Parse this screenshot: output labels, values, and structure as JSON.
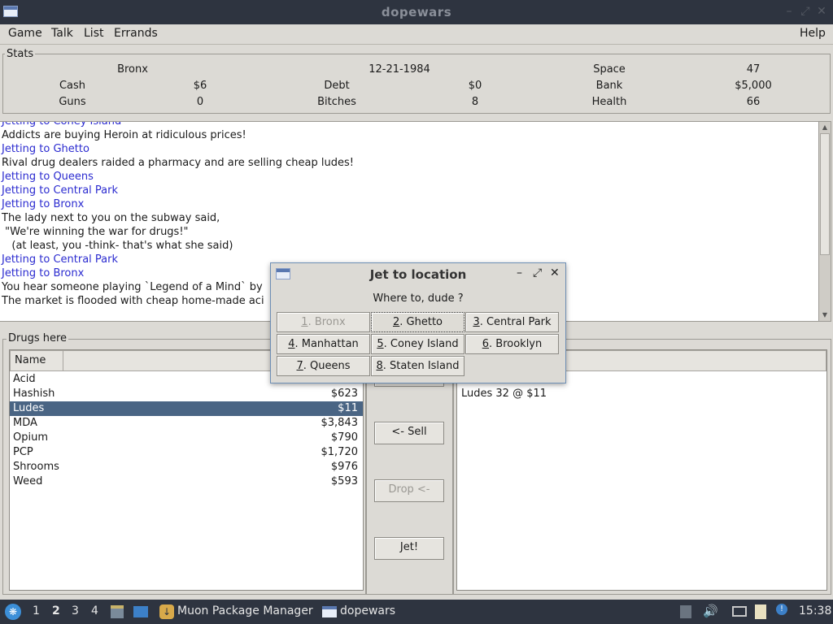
{
  "window": {
    "title": "dopewars"
  },
  "menu": {
    "game": "Game",
    "talk": "Talk",
    "list": "List",
    "errands": "Errands",
    "help": "Help"
  },
  "stats": {
    "frame_label": "Stats",
    "location": "Bronx",
    "date": "12-21-1984",
    "space_label": "Space",
    "space_value": "47",
    "cash_label": "Cash",
    "cash_value": "$6",
    "debt_label": "Debt",
    "debt_value": "$0",
    "bank_label": "Bank",
    "bank_value": "$5,000",
    "guns_label": "Guns",
    "guns_value": "0",
    "bitches_label": "Bitches",
    "bitches_value": "8",
    "health_label": "Health",
    "health_value": "66"
  },
  "log": [
    {
      "text": "Jetting to Coney Island",
      "kind": "travel"
    },
    {
      "text": "Addicts are buying Heroin at ridiculous prices!",
      "kind": "event"
    },
    {
      "text": "Jetting to Ghetto",
      "kind": "travel"
    },
    {
      "text": "Rival drug dealers raided a pharmacy and are selling cheap ludes!",
      "kind": "event"
    },
    {
      "text": "Jetting to Queens",
      "kind": "travel"
    },
    {
      "text": "Jetting to Central Park",
      "kind": "travel"
    },
    {
      "text": "Jetting to Bronx",
      "kind": "travel"
    },
    {
      "text": "The lady next to you on the subway said,",
      "kind": "event"
    },
    {
      "text": " \"We're winning the war for drugs!\"",
      "kind": "event"
    },
    {
      "text": "   (at least, you -think- that's what she said)",
      "kind": "event"
    },
    {
      "text": "Jetting to Central Park",
      "kind": "travel"
    },
    {
      "text": "Jetting to Bronx",
      "kind": "travel"
    },
    {
      "text": "You hear someone playing `Legend of a Mind` by",
      "kind": "event"
    },
    {
      "text": "The market is flooded with cheap home-made aci",
      "kind": "event"
    }
  ],
  "drugs_here": {
    "frame_label": "Drugs here",
    "column_name": "Name",
    "items": [
      {
        "name": "Acid",
        "price": ""
      },
      {
        "name": "Hashish",
        "price": "$623"
      },
      {
        "name": "Ludes",
        "price": "$11",
        "selected": true
      },
      {
        "name": "MDA",
        "price": "$3,843"
      },
      {
        "name": "Opium",
        "price": "$790"
      },
      {
        "name": "PCP",
        "price": "$1,720"
      },
      {
        "name": "Shrooms",
        "price": "$976"
      },
      {
        "name": "Weed",
        "price": "$593"
      }
    ]
  },
  "actions": {
    "sell": "<- Sell",
    "drop": "Drop <-",
    "jet": "Jet!"
  },
  "carried": {
    "items": [
      "Ludes  32 @ $11"
    ]
  },
  "dialog": {
    "title": "Jet to location",
    "prompt": "Where to, dude ?",
    "locations": [
      {
        "key": "1",
        "name": ". Bronx",
        "disabled": true
      },
      {
        "key": "2",
        "name": ". Ghetto",
        "focused": true
      },
      {
        "key": "3",
        "name": ". Central Park"
      },
      {
        "key": "4",
        "name": ". Manhattan"
      },
      {
        "key": "5",
        "name": ". Coney Island"
      },
      {
        "key": "6",
        "name": ". Brooklyn"
      },
      {
        "key": "7",
        "name": ". Queens"
      },
      {
        "key": "8",
        "name": ". Staten Island"
      }
    ]
  },
  "taskbar": {
    "workspaces": [
      "1",
      "2",
      "3",
      "4"
    ],
    "active_workspace": "2",
    "task1": "Muon Package Manager",
    "task2": "dopewars",
    "clock": "15:38"
  }
}
